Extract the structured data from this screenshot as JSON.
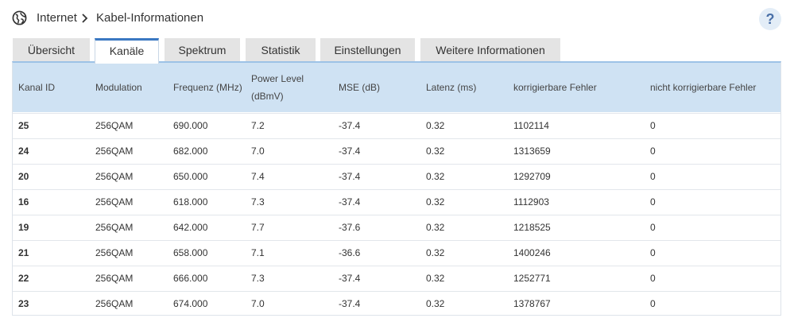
{
  "breadcrumb": {
    "item1": "Internet",
    "item2": "Kabel-Informationen"
  },
  "help_label": "?",
  "tabs": [
    {
      "label": "Übersicht",
      "active": false
    },
    {
      "label": "Kanäle",
      "active": true
    },
    {
      "label": "Spektrum",
      "active": false
    },
    {
      "label": "Statistik",
      "active": false
    },
    {
      "label": "Einstellungen",
      "active": false
    },
    {
      "label": "Weitere Informationen",
      "active": false
    }
  ],
  "table": {
    "headers": {
      "kanal_id": "Kanal ID",
      "modulation": "Modulation",
      "frequenz": "Frequenz (MHz)",
      "power_line1": "Power Level",
      "power_line2": "(dBmV)",
      "mse": "MSE (dB)",
      "latenz": "Latenz (ms)",
      "korr": "korrigierbare Fehler",
      "nkorr": "nicht korrigierbare Fehler"
    },
    "rows": [
      {
        "id": "25",
        "mod": "256QAM",
        "freq": "690.000",
        "power": "7.2",
        "mse": "-37.4",
        "lat": "0.32",
        "korr": "1102114",
        "nkorr": "0"
      },
      {
        "id": "24",
        "mod": "256QAM",
        "freq": "682.000",
        "power": "7.0",
        "mse": "-37.4",
        "lat": "0.32",
        "korr": "1313659",
        "nkorr": "0"
      },
      {
        "id": "20",
        "mod": "256QAM",
        "freq": "650.000",
        "power": "7.4",
        "mse": "-37.4",
        "lat": "0.32",
        "korr": "1292709",
        "nkorr": "0"
      },
      {
        "id": "16",
        "mod": "256QAM",
        "freq": "618.000",
        "power": "7.3",
        "mse": "-37.4",
        "lat": "0.32",
        "korr": "1112903",
        "nkorr": "0"
      },
      {
        "id": "19",
        "mod": "256QAM",
        "freq": "642.000",
        "power": "7.7",
        "mse": "-37.6",
        "lat": "0.32",
        "korr": "1218525",
        "nkorr": "0"
      },
      {
        "id": "21",
        "mod": "256QAM",
        "freq": "658.000",
        "power": "7.1",
        "mse": "-36.6",
        "lat": "0.32",
        "korr": "1400246",
        "nkorr": "0"
      },
      {
        "id": "22",
        "mod": "256QAM",
        "freq": "666.000",
        "power": "7.3",
        "mse": "-37.4",
        "lat": "0.32",
        "korr": "1252771",
        "nkorr": "0"
      },
      {
        "id": "23",
        "mod": "256QAM",
        "freq": "674.000",
        "power": "7.0",
        "mse": "-37.4",
        "lat": "0.32",
        "korr": "1378767",
        "nkorr": "0"
      }
    ]
  },
  "icons": {
    "globe": "globe-icon",
    "breadcrumb_separator": "chevron-right-icon"
  },
  "colors": {
    "active_tab_accent": "#3b78c2",
    "header_bg": "#cfe2f3",
    "inactive_tab_bg": "#e4e4e4"
  }
}
